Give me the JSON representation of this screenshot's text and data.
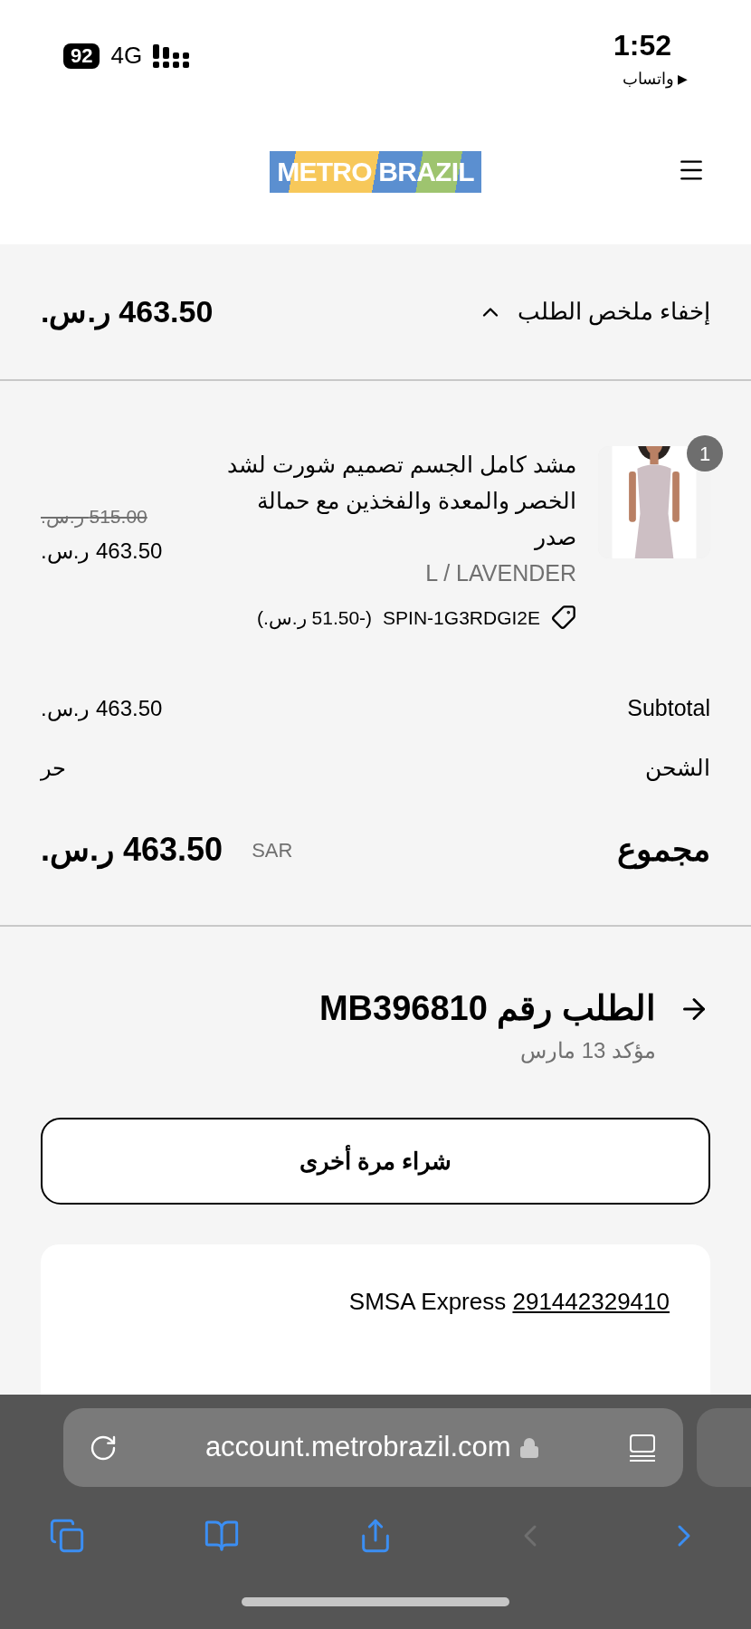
{
  "status_bar": {
    "time": "1:52",
    "back_app": "واتساب",
    "back_arrow": "▶",
    "battery": "92",
    "network": "4G"
  },
  "header": {
    "logo": "METRO BRAZIL"
  },
  "summary": {
    "toggle_label": "إخفاء ملخص الطلب",
    "expanded": true,
    "total": "463.50 ر.س."
  },
  "items": [
    {
      "title": "مشد كامل الجسم تصميم شورت لشد الخصر والمعدة والفخذين مع حمالة صدر",
      "quantity": "1",
      "variant": "L / LAVENDER",
      "discount_code": "SPIN-1G3RDGI2E",
      "discount_amount": "(-51.50 ر.س.)",
      "original_price": "515.00 ر.س.",
      "price": "463.50 ر.س."
    }
  ],
  "totals": [
    {
      "label": "Subtotal",
      "value": "463.50 ر.س."
    },
    {
      "label": "الشحن",
      "value": "حر"
    }
  ],
  "grand_total": {
    "label": "مجموع",
    "currency": "SAR",
    "value": "463.50 ر.س."
  },
  "order": {
    "title": "الطلب رقم MB396810",
    "status": "مؤكد 13 مارس",
    "buy_again": "شراء مرة أخرى"
  },
  "shipment": {
    "carrier": "SMSA Express",
    "tracking_number": "291442329410"
  },
  "browser": {
    "url": "account.metrobrazil.com",
    "toolbar": [
      {
        "kind": "tabs",
        "disabled": false
      },
      {
        "kind": "bookmarks",
        "disabled": false
      },
      {
        "kind": "share",
        "disabled": false
      },
      {
        "kind": "back",
        "disabled": true
      },
      {
        "kind": "forward",
        "disabled": false
      }
    ]
  }
}
